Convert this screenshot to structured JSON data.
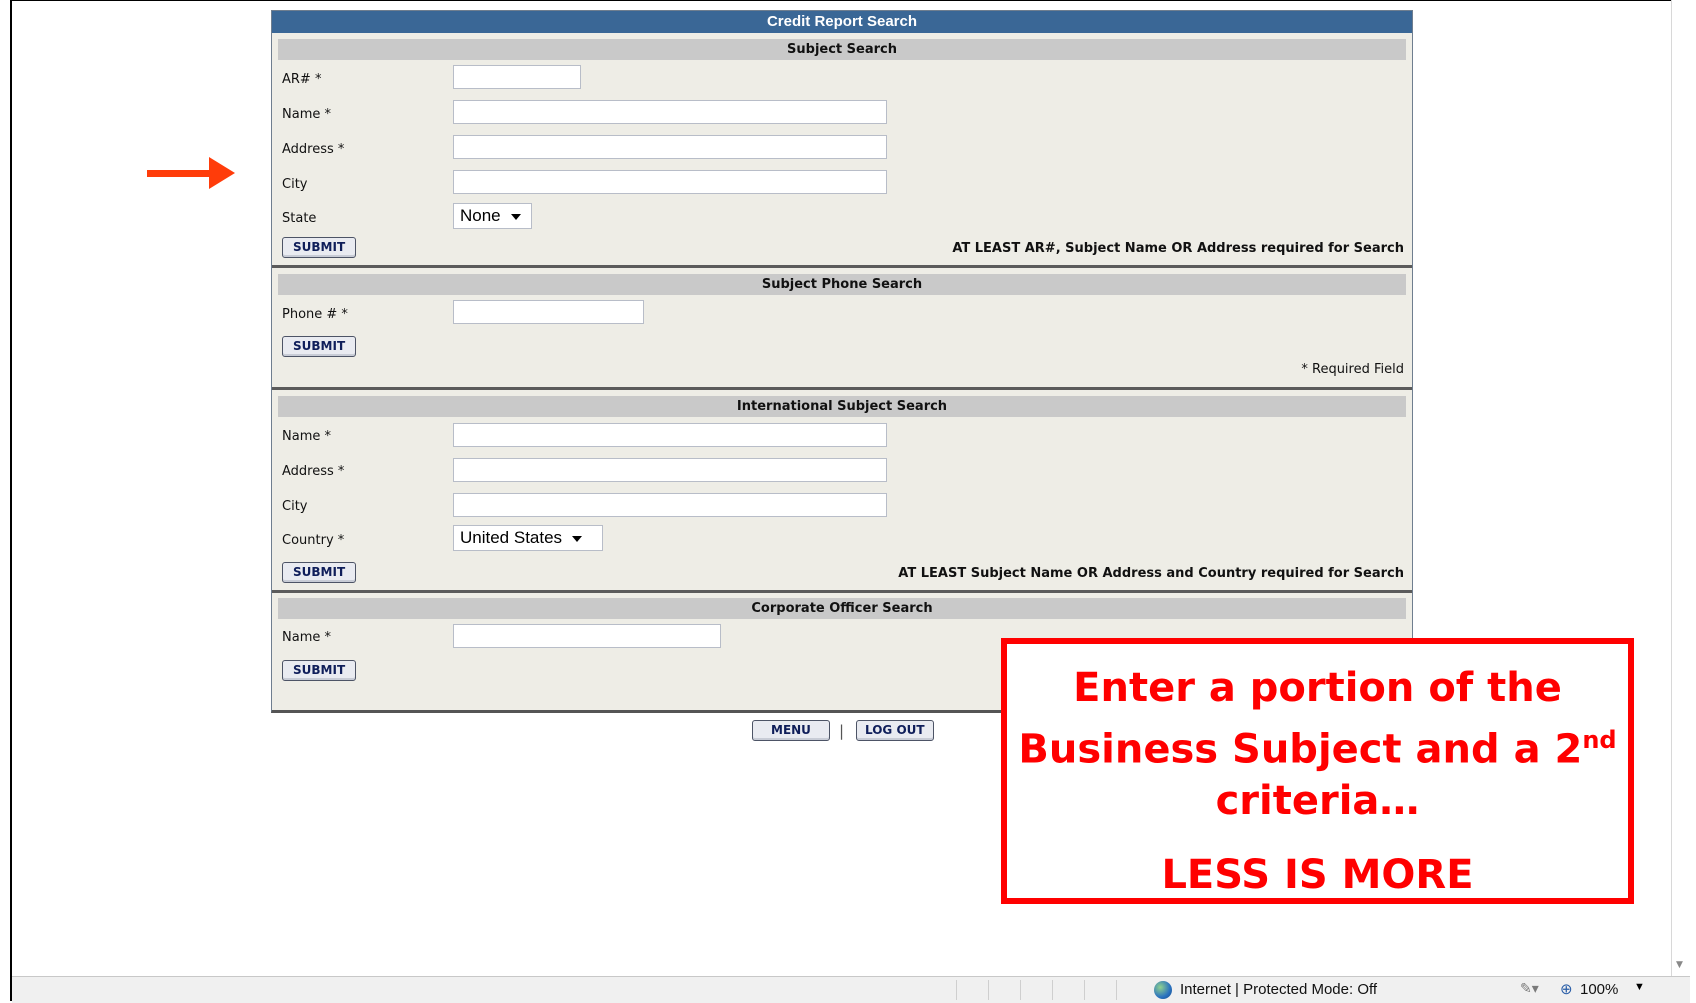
{
  "panel_title": "Credit Report Search",
  "subject_search": {
    "heading": "Subject Search",
    "fields": [
      {
        "label": "AR# *",
        "value": ""
      },
      {
        "label": "Name *",
        "value": ""
      },
      {
        "label": "Address *",
        "value": ""
      },
      {
        "label": "City",
        "value": ""
      }
    ],
    "state_label": "State",
    "state_value": "None",
    "submit": "SUBMIT",
    "note": "AT LEAST AR#, Subject Name OR Address required for Search"
  },
  "phone_search": {
    "heading": "Subject Phone Search",
    "phone_label": "Phone # *",
    "phone_value": "",
    "submit": "SUBMIT",
    "note": "* Required Field"
  },
  "international_search": {
    "heading": "International Subject Search",
    "fields": [
      {
        "label": "Name *",
        "value": ""
      },
      {
        "label": "Address *",
        "value": ""
      },
      {
        "label": "City",
        "value": ""
      }
    ],
    "country_label": "Country *",
    "country_value": "United States",
    "submit": "SUBMIT",
    "note": "AT LEAST Subject Name OR Address and Country required for Search"
  },
  "officer_search": {
    "heading": "Corporate Officer Search",
    "name_label": "Name *",
    "name_value": "",
    "submit": "SUBMIT"
  },
  "footer_nav": {
    "menu": "MENU",
    "separator": "|",
    "logout": "LOG OUT"
  },
  "callout": {
    "line1a": "Enter a portion of the",
    "line1b": "Business Subject and a 2",
    "sup": "nd",
    "line1c": "criteria…",
    "line2": "LESS IS MORE"
  },
  "status_bar": {
    "zone": "Internet | Protected Mode: Off",
    "zoom": "100%"
  },
  "colors": {
    "title_bar": "#3a6796",
    "panel_bg": "#eeede6",
    "callout": "#ff0000",
    "arrow": "#ff3c0a"
  }
}
